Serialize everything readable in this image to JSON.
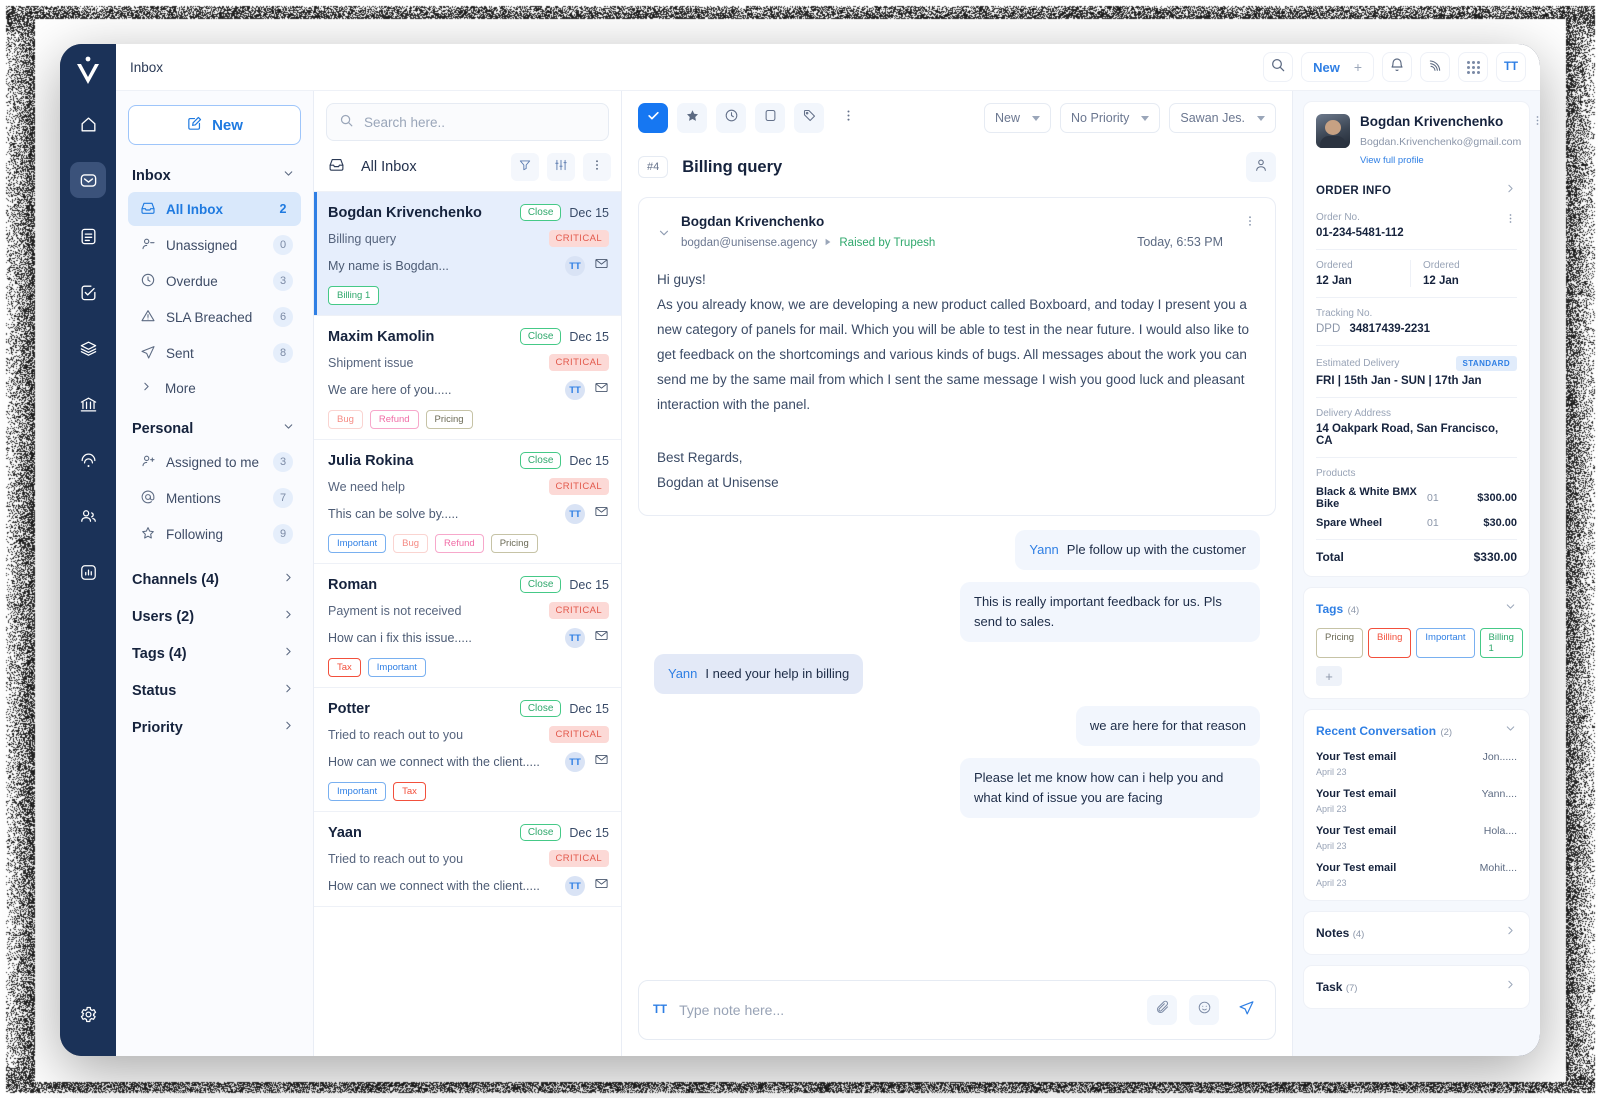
{
  "topbar": {
    "title": "Inbox",
    "new_label": "New",
    "plus": "+",
    "avatar_initials": "TT",
    "icons": [
      "search-icon",
      "bell-icon",
      "broadcast-icon",
      "apps-grid-icon"
    ]
  },
  "rail": {
    "logo": "unisense-logo",
    "items": [
      {
        "name": "home-icon",
        "active": false
      },
      {
        "name": "mail-icon",
        "active": true
      },
      {
        "name": "document-icon",
        "active": false
      },
      {
        "name": "tasks-check-icon",
        "active": false
      },
      {
        "name": "layers-icon",
        "active": false
      },
      {
        "name": "bank-icon",
        "active": false
      },
      {
        "name": "broadcast-icon",
        "active": false
      },
      {
        "name": "contacts-icon",
        "active": false
      },
      {
        "name": "reports-chart-icon",
        "active": false
      }
    ],
    "settings": "gear-icon"
  },
  "folders": {
    "new_button": "New",
    "inbox_group": "Inbox",
    "inbox_items": [
      {
        "label": "All Inbox",
        "count": "2",
        "icon": "inbox-icon",
        "selected": true
      },
      {
        "label": "Unassigned",
        "count": "0",
        "icon": "user-minus-icon",
        "selected": false
      },
      {
        "label": "Overdue",
        "count": "3",
        "icon": "clock-icon",
        "selected": false
      },
      {
        "label": "SLA Breached",
        "count": "6",
        "icon": "warning-triangle-icon",
        "selected": false
      },
      {
        "label": "Sent",
        "count": "8",
        "icon": "send-icon",
        "selected": false
      }
    ],
    "more_label": "More",
    "personal_group": "Personal",
    "personal_items": [
      {
        "label": "Assigned to me",
        "count": "3",
        "icon": "user-plus-icon"
      },
      {
        "label": "Mentions",
        "count": "7",
        "icon": "at-icon"
      },
      {
        "label": "Following",
        "count": "9",
        "icon": "star-outline-icon"
      }
    ],
    "sections": [
      "Channels (4)",
      "Users (2)",
      "Tags (4)",
      "Status",
      "Priority"
    ]
  },
  "list": {
    "search_placeholder": "Search here..",
    "header_title": "All Inbox",
    "header_icons": [
      "filter-icon",
      "sort-settings-icon",
      "more-vertical-icon"
    ],
    "conversations": [
      {
        "name": "Bogdan Krivenchenko",
        "status": "Close",
        "date": "Dec 15",
        "subject": "Billing query",
        "priority": "CRITICAL",
        "snippet": "My name is Bogdan...",
        "avatar": "TT",
        "tags": [
          {
            "label": "Billing 1",
            "style": "t-billing1"
          }
        ],
        "active": true
      },
      {
        "name": "Maxim Kamolin",
        "status": "Close",
        "date": "Dec 15",
        "subject": "Shipment issue",
        "priority": "CRITICAL",
        "snippet": "We are here of you.....",
        "avatar": "TT",
        "tags": [
          {
            "label": "Bug",
            "style": "t-bug"
          },
          {
            "label": "Refund",
            "style": "t-refund"
          },
          {
            "label": "Pricing",
            "style": "t-pricing"
          }
        ],
        "active": false
      },
      {
        "name": "Julia Rokina",
        "status": "Close",
        "date": "Dec 15",
        "subject": "We need help",
        "priority": "CRITICAL",
        "snippet": "This can be solve by.....",
        "avatar": "TT",
        "tags": [
          {
            "label": "Important",
            "style": "t-important"
          },
          {
            "label": "Bug",
            "style": "t-bug"
          },
          {
            "label": "Refund",
            "style": "t-refund"
          },
          {
            "label": "Pricing",
            "style": "t-pricing"
          }
        ],
        "active": false
      },
      {
        "name": "Roman",
        "status": "Close",
        "date": "Dec 15",
        "subject": "Payment is not received",
        "priority": "CRITICAL",
        "snippet": "How can i fix this issue.....",
        "avatar": "TT",
        "tags": [
          {
            "label": "Tax",
            "style": "t-tax"
          },
          {
            "label": "Important",
            "style": "t-important"
          }
        ],
        "active": false
      },
      {
        "name": "Potter",
        "status": "Close",
        "date": "Dec 15",
        "subject": "Tried to reach out to you",
        "priority": "CRITICAL",
        "snippet": "How can we connect with the client.....",
        "avatar": "TT",
        "tags": [
          {
            "label": "Important",
            "style": "t-important"
          },
          {
            "label": "Tax",
            "style": "t-tax"
          }
        ],
        "active": false
      },
      {
        "name": "Yaan",
        "status": "Close",
        "date": "Dec 15",
        "subject": "Tried to reach out to you",
        "priority": "CRITICAL",
        "snippet": "How can we connect with the client.....",
        "avatar": "TT",
        "tags": [],
        "active": false
      }
    ]
  },
  "main": {
    "toolbar_icons": [
      "check-icon",
      "star-icon",
      "clock-icon",
      "folder-icon",
      "tag-icon",
      "more-vertical-icon"
    ],
    "dropdowns": [
      {
        "label": "New"
      },
      {
        "label": "No Priority"
      },
      {
        "label": "Sawan Jes."
      }
    ],
    "ticket_number": "#4",
    "title": "Billing query",
    "assign_icon": "assign-user-icon",
    "email": {
      "from": "Bogdan Krivenchenko",
      "address": "bogdan@unisense.agency",
      "raised_by": "Raised by Trupesh",
      "time": "Today, 6:53 PM",
      "greeting": "Hi guys!",
      "body": "As you already know, we are developing a new product called Boxboard, and today I present you a new category of panels for mail. Which you will be able to test in the near future. I would also like to get feedback on the shortcomings and various kinds of bugs. All messages about the work you can send me by the same mail from which I sent the same message I wish you good luck and pleasant interaction with the panel.",
      "sign_off": "Best Regards,",
      "signature": "Bogdan at Unisense"
    },
    "bubbles": [
      {
        "side": "right",
        "mention": "Yann",
        "text": "Ple follow up with the customer",
        "style": "pale"
      },
      {
        "side": "right",
        "mention": "",
        "text": "This is really important feedback for us. Pls send to sales.",
        "style": "pale"
      },
      {
        "side": "left",
        "mention": "Yann",
        "text": "I need your help in billing",
        "style": "blue"
      },
      {
        "side": "right",
        "mention": "",
        "text": "we are here for that reason",
        "style": "pale"
      },
      {
        "side": "right",
        "mention": "",
        "text": "Please let me know how can i help you and what kind of issue you are facing",
        "style": "pale"
      }
    ],
    "composer": {
      "avatar": "TT",
      "placeholder": "Type note here...",
      "icons": [
        "attachment-icon",
        "emoji-icon",
        "send-icon"
      ]
    }
  },
  "details": {
    "profile": {
      "name": "Bogdan Krivenchenko",
      "email": "Bogdan.Krivenchenko@gmail.com",
      "link": "View full profile"
    },
    "order_info": {
      "section_title": "ORDER INFO",
      "order_no_label": "Order No.",
      "order_no": "01-234-5481-112",
      "ordered_label_1": "Ordered",
      "ordered_1": "12 Jan",
      "ordered_label_2": "Ordered",
      "ordered_2": "12 Jan",
      "tracking_label": "Tracking No.",
      "tracking_carrier": "DPD",
      "tracking_no": "34817439-2231",
      "delivery_label": "Estimated Delivery",
      "delivery_badge": "STANDARD",
      "delivery_value": "FRI  |  15th Jan - SUN  |  17th Jan",
      "address_label": "Delivery Address",
      "address": "14 Oakpark Road, San Francisco, CA",
      "products_label": "Products",
      "products": [
        {
          "name": "Black & White BMX Bike",
          "qty": "01",
          "price": "$300.00"
        },
        {
          "name": "Spare Wheel",
          "qty": "01",
          "price": "$30.00"
        }
      ],
      "total_label": "Total",
      "total_value": "$330.00"
    },
    "tags": {
      "title": "Tags",
      "count": "(4)",
      "items": [
        {
          "label": "Pricing",
          "style": "t-pricing"
        },
        {
          "label": "Billing",
          "style": "t-billing"
        },
        {
          "label": "Important",
          "style": "t-important"
        },
        {
          "label": "Billing 1",
          "style": "t-billing1"
        }
      ],
      "add": "+"
    },
    "recent": {
      "title": "Recent Conversation",
      "count": "(2)",
      "items": [
        {
          "title": "Your Test email",
          "date": "April 23",
          "who": "Jon......"
        },
        {
          "title": "Your Test email",
          "date": "April 23",
          "who": "Yann...."
        },
        {
          "title": "Your Test email",
          "date": "April 23",
          "who": "Hola...."
        },
        {
          "title": "Your Test email",
          "date": "April 23",
          "who": "Mohit...."
        }
      ]
    },
    "notes": {
      "title": "Notes",
      "count": "(4)"
    },
    "task": {
      "title": "Task",
      "count": "(7)"
    }
  },
  "colors": {
    "accent": "#2f7fe4",
    "rail_bg": "#1b3258",
    "critical": "#e2594c",
    "success": "#2fa86c"
  }
}
